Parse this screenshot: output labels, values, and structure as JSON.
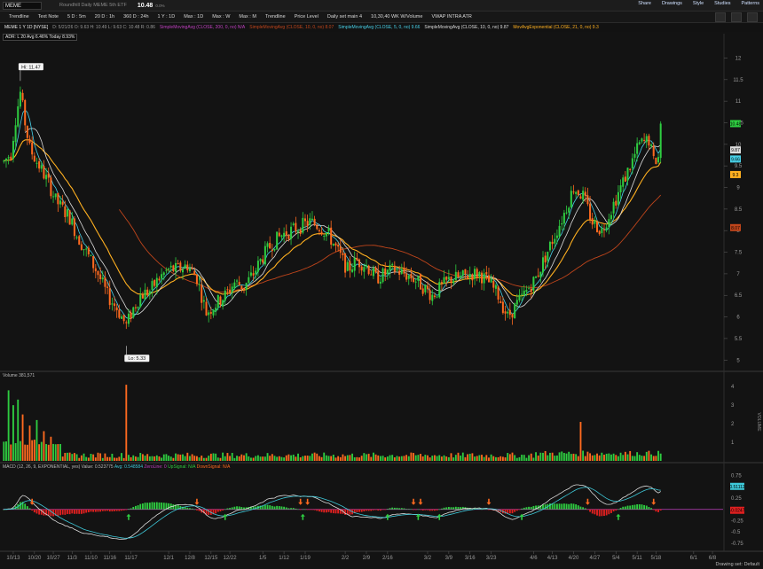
{
  "header": {
    "symbol": "MEME",
    "description": "Roundhill Daily MEME 5th ETF",
    "last": "10.48",
    "change": "0.0%",
    "buttons": [
      "Share",
      "Drawings",
      "Style",
      "Studies",
      "Patterns"
    ]
  },
  "toolbar": {
    "items": [
      "Trendline",
      "Text Note",
      "5 D : 5m",
      "20 D : 1h",
      "360 D : 24h",
      "1 Y : 1D",
      "Max : 1D",
      "Max : W",
      "Max : M",
      "Trendline",
      "Price Level",
      "Daily set main 4",
      "10,30,40 WK W/Volume",
      "VWAP INTRA ATR"
    ]
  },
  "studies_row": {
    "title": "MEME 1 Y 1D [NYSE]",
    "ohlc": "D: 5/21/26   O: 9.63   H: 10.49   L: 9.63   C: 10.48   R: 0.86",
    "sma200": "SimpleMovingAvg (CLOSE, 200, 0, no)  N/A",
    "sma10": "SimpleMovingAvg (CLOSE, 10, 0, no)  8.07",
    "sma5": "SimpleMovingAvg (CLOSE, 5, 0, no)  9.66",
    "sma10b": "SimpleMovingAvg (CLOSE, 10, 0, no)  9.87",
    "ema21": "MovAvgExponential (CLOSE, 21, 0, no)  9.3"
  },
  "adr_label": "ADR: L 20  Avg 6.46%  Today 8.93%",
  "volume_label": "Volume  381,571",
  "macd_labels": {
    "macd": "MACD (12, 26, 9, EXPONENTIAL, yes)  Value: 0.523775",
    "avg": "Avg: 0.548584",
    "zero": "ZeroLine: 0",
    "up": "UpSignal: N/A",
    "down": "DownSignal: N/A"
  },
  "drawing_set": "Drawing set: Default",
  "colors": {
    "up": "#2ecc40",
    "down": "#ff6a1f",
    "sma5": "#48d1e8",
    "sma10": "#dddddd",
    "ema21": "#ffb020",
    "sma50": "#c0451b",
    "macd_line": "#dcdcdc",
    "signal_line": "#3ec8d8",
    "hist_up": "#2ecc40",
    "hist_down": "#e02020",
    "zero_line": "#c040c0"
  },
  "chart_data": {
    "type": "candlestick",
    "price_axis": {
      "min": 4.8,
      "max": 12.4,
      "ticks": [
        5,
        5.5,
        6,
        6.5,
        7,
        7.5,
        8,
        8.5,
        9,
        9.5,
        10,
        10.5,
        11,
        11.5,
        12
      ]
    },
    "price_tags": [
      {
        "value": "10.48",
        "price": 10.48,
        "color": "#2ecc40"
      },
      {
        "value": "9.87",
        "price": 9.87,
        "color": "#dddddd"
      },
      {
        "value": "9.66",
        "price": 9.66,
        "color": "#48d1e8"
      },
      {
        "value": "9.3",
        "price": 9.3,
        "color": "#ffb020"
      },
      {
        "value": "8.07",
        "price": 8.07,
        "color": "#c0451b"
      }
    ],
    "high_annotation": {
      "text": "Hi: 11.47",
      "price": 11.47,
      "bar": 7
    },
    "low_annotation": {
      "text": "Lo: 5.33",
      "price": 5.33,
      "bar": 52
    },
    "x_labels": [
      {
        "label": "10/13",
        "bar": 4
      },
      {
        "label": "10/20",
        "bar": 13
      },
      {
        "label": "10/27",
        "bar": 21
      },
      {
        "label": "11/3",
        "bar": 29
      },
      {
        "label": "11/10",
        "bar": 37
      },
      {
        "label": "11/16",
        "bar": 45
      },
      {
        "label": "11/17",
        "bar": 54
      },
      {
        "label": "12/1",
        "bar": 70
      },
      {
        "label": "12/8",
        "bar": 79
      },
      {
        "label": "12/15",
        "bar": 88
      },
      {
        "label": "12/22",
        "bar": 96
      },
      {
        "label": "1/5",
        "bar": 110
      },
      {
        "label": "1/12",
        "bar": 119
      },
      {
        "label": "1/19",
        "bar": 128
      },
      {
        "label": "2/2",
        "bar": 145
      },
      {
        "label": "2/9",
        "bar": 154
      },
      {
        "label": "2/16",
        "bar": 163
      },
      {
        "label": "3/2",
        "bar": 180
      },
      {
        "label": "3/9",
        "bar": 189
      },
      {
        "label": "3/16",
        "bar": 198
      },
      {
        "label": "3/23",
        "bar": 207
      },
      {
        "label": "4/6",
        "bar": 225
      },
      {
        "label": "4/13",
        "bar": 233
      },
      {
        "label": "4/20",
        "bar": 242
      },
      {
        "label": "4/27",
        "bar": 251
      },
      {
        "label": "5/4",
        "bar": 260
      },
      {
        "label": "5/11",
        "bar": 269
      },
      {
        "label": "5/18",
        "bar": 277
      },
      {
        "label": "6/1",
        "bar": 293
      },
      {
        "label": "6/8",
        "bar": 301
      }
    ],
    "total_slots": 306,
    "anchors": [
      [
        0,
        9.6
      ],
      [
        3,
        9.8
      ],
      [
        5,
        10.6
      ],
      [
        7,
        11.2
      ],
      [
        9,
        10.5
      ],
      [
        11,
        9.9
      ],
      [
        13,
        9.7
      ],
      [
        16,
        9.4
      ],
      [
        19,
        9.1
      ],
      [
        22,
        8.7
      ],
      [
        25,
        8.5
      ],
      [
        28,
        8.3
      ],
      [
        31,
        7.9
      ],
      [
        34,
        7.6
      ],
      [
        37,
        7.3
      ],
      [
        40,
        7.0
      ],
      [
        44,
        6.5
      ],
      [
        48,
        6.2
      ],
      [
        52,
        5.8
      ],
      [
        55,
        6.2
      ],
      [
        58,
        6.5
      ],
      [
        62,
        6.6
      ],
      [
        66,
        6.9
      ],
      [
        70,
        7.1
      ],
      [
        74,
        7.1
      ],
      [
        78,
        7.2
      ],
      [
        82,
        6.9
      ],
      [
        86,
        6.1
      ],
      [
        90,
        6.3
      ],
      [
        94,
        6.5
      ],
      [
        98,
        6.8
      ],
      [
        102,
        6.7
      ],
      [
        106,
        7.0
      ],
      [
        110,
        7.4
      ],
      [
        114,
        7.7
      ],
      [
        118,
        7.9
      ],
      [
        122,
        8.0
      ],
      [
        126,
        8.1
      ],
      [
        130,
        8.2
      ],
      [
        134,
        8.1
      ],
      [
        138,
        7.9
      ],
      [
        142,
        7.5
      ],
      [
        146,
        7.1
      ],
      [
        150,
        7.3
      ],
      [
        154,
        7.2
      ],
      [
        158,
        6.9
      ],
      [
        162,
        7.0
      ],
      [
        166,
        7.1
      ],
      [
        170,
        7.0
      ],
      [
        174,
        6.9
      ],
      [
        178,
        6.7
      ],
      [
        182,
        6.5
      ],
      [
        186,
        6.7
      ],
      [
        190,
        6.9
      ],
      [
        194,
        6.9
      ],
      [
        198,
        7.0
      ],
      [
        202,
        7.0
      ],
      [
        206,
        6.8
      ],
      [
        210,
        6.5
      ],
      [
        214,
        6.0
      ],
      [
        218,
        6.3
      ],
      [
        222,
        6.6
      ],
      [
        226,
        6.9
      ],
      [
        230,
        7.4
      ],
      [
        234,
        7.9
      ],
      [
        238,
        8.4
      ],
      [
        242,
        9.0
      ],
      [
        246,
        8.8
      ],
      [
        250,
        8.2
      ],
      [
        254,
        8.0
      ],
      [
        258,
        8.5
      ],
      [
        262,
        9.0
      ],
      [
        266,
        9.5
      ],
      [
        270,
        10.0
      ],
      [
        274,
        10.1
      ],
      [
        276,
        9.6
      ],
      [
        278,
        9.7
      ],
      [
        279,
        10.48
      ]
    ],
    "volume_axis": {
      "min": 0,
      "max": 4.2,
      "ticks": [
        1,
        2,
        3,
        4
      ],
      "label": "VOLUME"
    },
    "volume_spikes": [
      {
        "bar": 2,
        "value": 3.8
      },
      {
        "bar": 4,
        "value": 3.0
      },
      {
        "bar": 6,
        "value": 3.3
      },
      {
        "bar": 8,
        "value": 2.5
      },
      {
        "bar": 11,
        "value": 1.9
      },
      {
        "bar": 14,
        "value": 2.2
      },
      {
        "bar": 17,
        "value": 1.6
      },
      {
        "bar": 20,
        "value": 1.3
      },
      {
        "bar": 52,
        "value": 4.1
      },
      {
        "bar": 245,
        "value": 2.1
      }
    ],
    "macd_axis": {
      "min": -0.85,
      "max": 0.8,
      "ticks": [
        0.75,
        0.5,
        0.25,
        0,
        -0.25,
        -0.5,
        -0.75
      ]
    },
    "macd_tags": [
      {
        "value": "0.51112",
        "v": 0.51,
        "color": "#3ec8d8"
      },
      {
        "value": "-0.0247",
        "v": -0.02,
        "color": "#e02020"
      }
    ]
  }
}
